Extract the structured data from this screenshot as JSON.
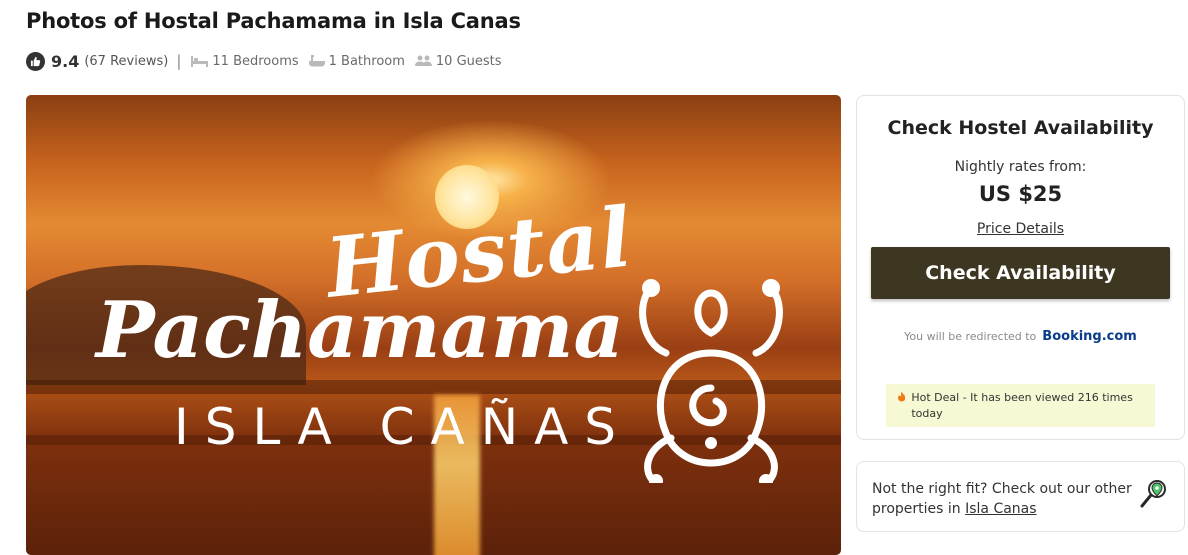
{
  "page": {
    "title": "Photos of Hostal Pachamama in Isla Canas"
  },
  "summary": {
    "rating": "9.4",
    "reviews": "(67 Reviews)",
    "separator": "|",
    "bedrooms": "11 Bedrooms",
    "bathrooms": "1 Bathroom",
    "guests": "10 Guests",
    "icons": [
      "thumbs-up-icon",
      "bed-icon",
      "bathtub-icon",
      "guests-icon"
    ]
  },
  "photo": {
    "logo_line1": "Hostal",
    "logo_line2": "Pachamama",
    "logo_line3": "ISLA CAÑAS"
  },
  "availability": {
    "heading": "Check Hostel Availability",
    "rates_label": "Nightly rates from:",
    "price": "US $25",
    "details_link": "Price Details",
    "button_label": "Check Availability",
    "redirect_text": "You will be redirected to",
    "redirect_brand": "Booking.com",
    "hot_deal": "Hot Deal - It has been viewed 216 times today",
    "button_color": "#3d3722",
    "hot_deal_bg": "#f6f9d4"
  },
  "alternatives": {
    "text": "Not the right fit? Check out our other properties in",
    "link": "Isla Canas"
  }
}
